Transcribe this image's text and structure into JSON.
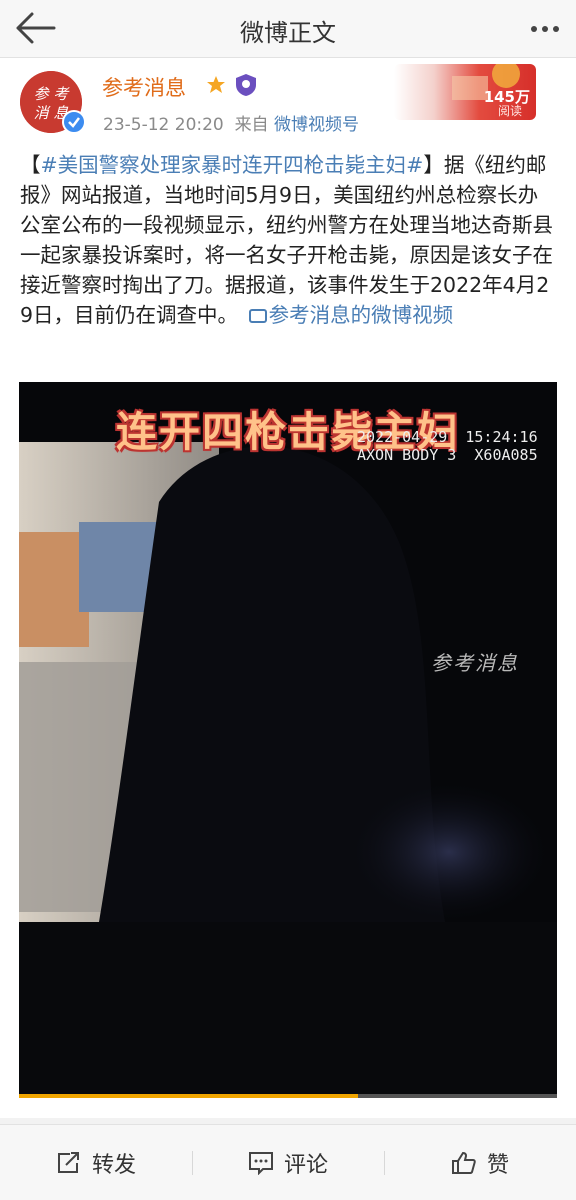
{
  "header": {
    "title": "微博正文"
  },
  "post": {
    "author": "参考消息",
    "avatar_text": "参考消息",
    "time": "23-5-12 20:20",
    "from_label": "来自",
    "source": "微博视频号",
    "views_count": "145万",
    "views_label": "阅读",
    "bracket_open": "【",
    "hashtag": "#美国警察处理家暴时连开四枪击毙主妇#",
    "bracket_close": "】",
    "body": "据《纽约邮报》网站报道，当地时间5月9日，美国纽约州总检察长办公室公布的一段视频显示，纽约州警方在处理当地达奇斯县一起家暴投诉案时，将一名女子开枪击毙，原因是该女子在接近警察时掏出了刀。据报道，该事件发生于2022年4月29日，目前仍在调查中。",
    "video_link": "参考消息的微博视频"
  },
  "video": {
    "caption": "连开四枪击毙主妇",
    "timestamp": "2022-04-29  15:24:16",
    "camera_id": "AXON BODY 3  X60A085",
    "watermark": "参考消息",
    "progress": 0.63
  },
  "actions": {
    "repost": "转发",
    "comment": "评论",
    "like": "赞"
  },
  "colors": {
    "link": "#4a7eb5",
    "author": "#e06c1a",
    "progress": "#f0a500"
  }
}
